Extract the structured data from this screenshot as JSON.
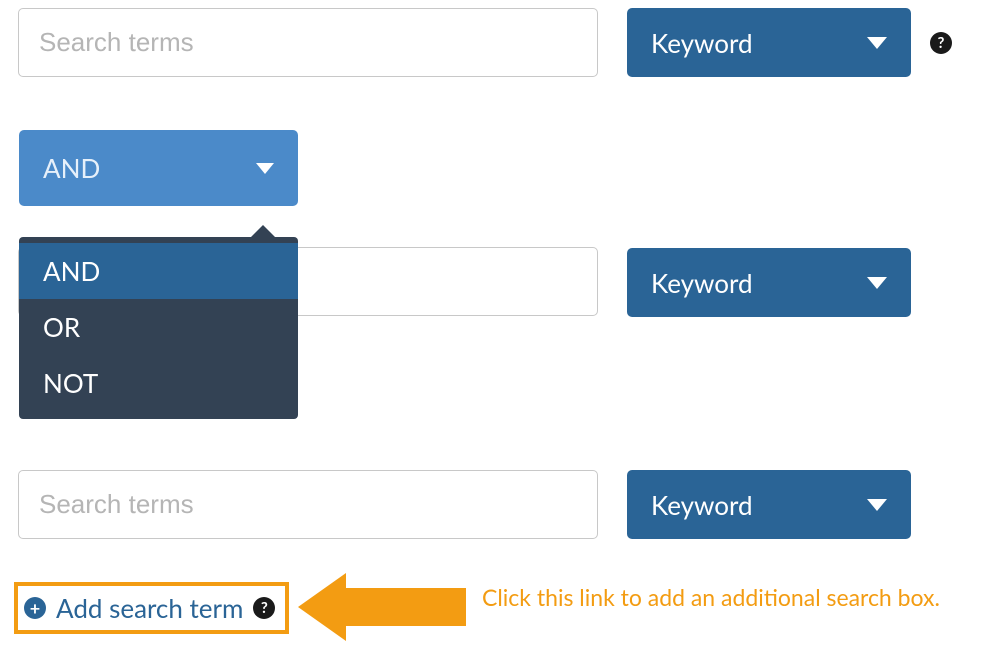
{
  "rows": [
    {
      "placeholder": "Search terms",
      "value": "",
      "field": "Keyword"
    },
    {
      "placeholder": "",
      "value": "",
      "field": "Keyword"
    },
    {
      "placeholder": "Search terms",
      "value": "",
      "field": "Keyword"
    }
  ],
  "boolean_operator": {
    "selected": "AND",
    "options": [
      "AND",
      "OR",
      "NOT"
    ]
  },
  "help_glyph": "?",
  "add_term": {
    "label": "Add search term",
    "plus_glyph": "+"
  },
  "annotation": {
    "text": "Click this link to add an additional search box."
  },
  "colors": {
    "primary": "#2a6496",
    "operator_button": "#4b8ac9",
    "dropdown_bg": "#334254",
    "highlight": "#f39c12"
  }
}
